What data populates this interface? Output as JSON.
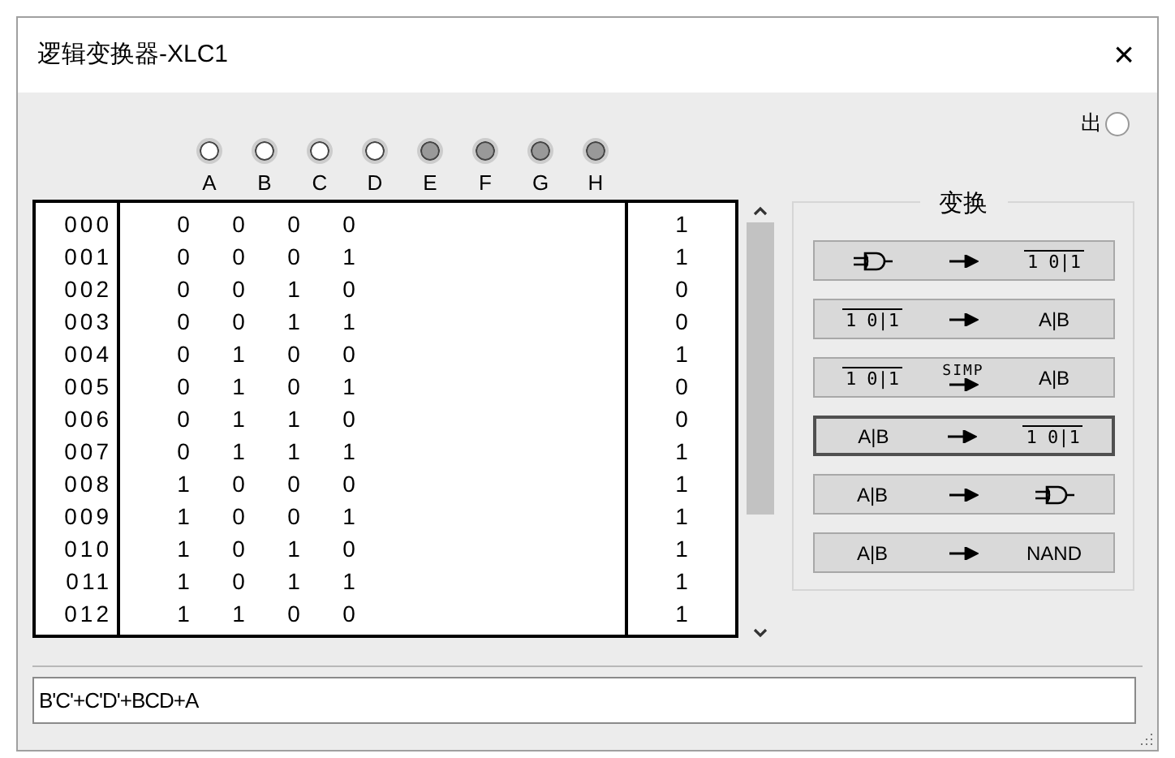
{
  "window": {
    "title": "逻辑变换器-XLC1",
    "close": "×"
  },
  "inputs": [
    {
      "label": "A",
      "active": true
    },
    {
      "label": "B",
      "active": true
    },
    {
      "label": "C",
      "active": true
    },
    {
      "label": "D",
      "active": true
    },
    {
      "label": "E",
      "active": false
    },
    {
      "label": "F",
      "active": false
    },
    {
      "label": "G",
      "active": false
    },
    {
      "label": "H",
      "active": false
    }
  ],
  "output": {
    "label": "出",
    "active": true
  },
  "table": {
    "rows": [
      {
        "index": "000",
        "inputs": [
          "0",
          "0",
          "0",
          "0"
        ],
        "output": "1"
      },
      {
        "index": "001",
        "inputs": [
          "0",
          "0",
          "0",
          "1"
        ],
        "output": "1"
      },
      {
        "index": "002",
        "inputs": [
          "0",
          "0",
          "1",
          "0"
        ],
        "output": "0"
      },
      {
        "index": "003",
        "inputs": [
          "0",
          "0",
          "1",
          "1"
        ],
        "output": "0"
      },
      {
        "index": "004",
        "inputs": [
          "0",
          "1",
          "0",
          "0"
        ],
        "output": "1"
      },
      {
        "index": "005",
        "inputs": [
          "0",
          "1",
          "0",
          "1"
        ],
        "output": "0"
      },
      {
        "index": "006",
        "inputs": [
          "0",
          "1",
          "1",
          "0"
        ],
        "output": "0"
      },
      {
        "index": "007",
        "inputs": [
          "0",
          "1",
          "1",
          "1"
        ],
        "output": "1"
      },
      {
        "index": "008",
        "inputs": [
          "1",
          "0",
          "0",
          "0"
        ],
        "output": "1"
      },
      {
        "index": "009",
        "inputs": [
          "1",
          "0",
          "0",
          "1"
        ],
        "output": "1"
      },
      {
        "index": "010",
        "inputs": [
          "1",
          "0",
          "1",
          "0"
        ],
        "output": "1"
      },
      {
        "index": "011",
        "inputs": [
          "1",
          "0",
          "1",
          "1"
        ],
        "output": "1"
      },
      {
        "index": "012",
        "inputs": [
          "1",
          "1",
          "0",
          "0"
        ],
        "output": "1"
      }
    ]
  },
  "conversions": {
    "title": "变换",
    "buttons": [
      {
        "selected": false,
        "from": {
          "kind": "gate"
        },
        "via": {
          "kind": "arrow"
        },
        "to": {
          "kind": "table",
          "text": "1 0|1"
        }
      },
      {
        "selected": false,
        "from": {
          "kind": "table",
          "text": "1 0|1"
        },
        "via": {
          "kind": "arrow"
        },
        "to": {
          "kind": "text",
          "text": "A|B"
        }
      },
      {
        "selected": false,
        "from": {
          "kind": "table",
          "text": "1 0|1"
        },
        "via": {
          "kind": "simp",
          "text": "SIMP"
        },
        "to": {
          "kind": "text",
          "text": "A|B"
        }
      },
      {
        "selected": true,
        "from": {
          "kind": "text",
          "text": "A|B"
        },
        "via": {
          "kind": "arrow"
        },
        "to": {
          "kind": "table",
          "text": "1 0|1"
        }
      },
      {
        "selected": false,
        "from": {
          "kind": "text",
          "text": "A|B"
        },
        "via": {
          "kind": "arrow"
        },
        "to": {
          "kind": "gate"
        }
      },
      {
        "selected": false,
        "from": {
          "kind": "text",
          "text": "A|B"
        },
        "via": {
          "kind": "arrow"
        },
        "to": {
          "kind": "text",
          "text": "NAND"
        }
      }
    ]
  },
  "expression": {
    "value": "B'C'+C'D'+BCD+A"
  }
}
